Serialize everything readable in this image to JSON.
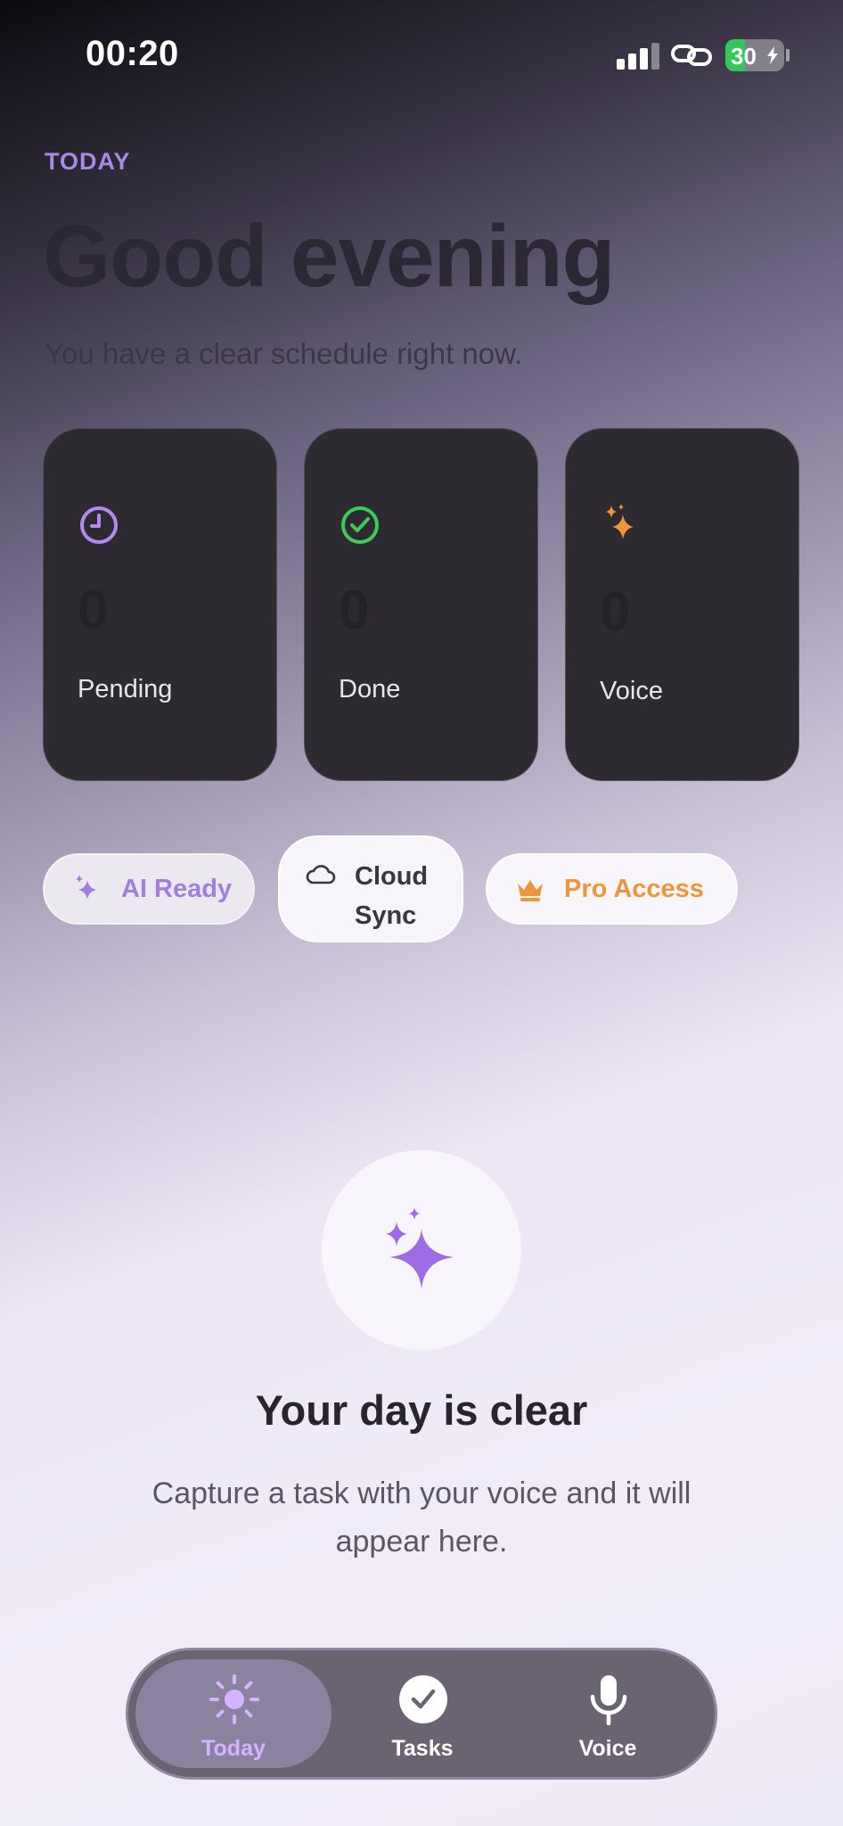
{
  "status_bar": {
    "time": "00:20",
    "battery": "30"
  },
  "header": {
    "eyebrow": "TODAY",
    "greeting": "Good evening",
    "subtitle": "You have a clear schedule right now."
  },
  "stats": [
    {
      "label": "Pending",
      "value": "0",
      "icon": "clock-icon",
      "color": "#b58af0"
    },
    {
      "label": "Done",
      "value": "0",
      "icon": "check-circle-icon",
      "color": "#3ec95a"
    },
    {
      "label": "Voice",
      "value": "0",
      "icon": "sparkles-icon",
      "color": "#f0963a"
    }
  ],
  "badges": {
    "ai": "AI Ready",
    "cloud_line1": "Cloud",
    "cloud_line2": "Sync",
    "pro": "Pro Access"
  },
  "empty_state": {
    "title": "Your day is clear",
    "body": "Capture a task with your voice and it will appear here."
  },
  "tabbar": {
    "tabs": [
      {
        "label": "Today",
        "icon": "sun-icon",
        "selected": true
      },
      {
        "label": "Tasks",
        "icon": "checkmark-circle-icon",
        "selected": false
      },
      {
        "label": "Voice",
        "icon": "microphone-icon",
        "selected": false
      }
    ]
  },
  "colors": {
    "accent_purple": "#a989e6",
    "orange": "#f0963a",
    "green": "#3ec95a"
  }
}
